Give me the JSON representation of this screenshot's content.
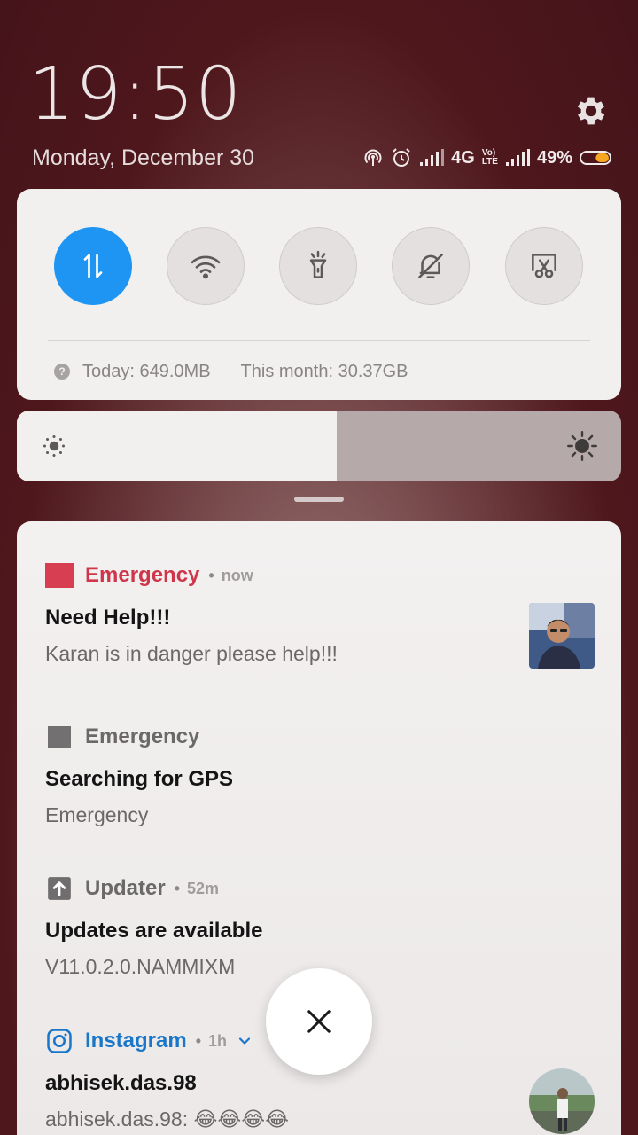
{
  "header": {
    "time": "19:50",
    "date": "Monday, December 30",
    "network_type": "4G",
    "volte_top": "Vo)",
    "volte_bottom": "LTE",
    "battery_percent": "49%",
    "battery_level": 0.49
  },
  "quick_settings": {
    "toggles": [
      {
        "name": "mobile-data",
        "icon": "data-arrows-icon",
        "active": true
      },
      {
        "name": "wifi",
        "icon": "wifi-icon",
        "active": false
      },
      {
        "name": "flashlight",
        "icon": "flashlight-icon",
        "active": false
      },
      {
        "name": "silent",
        "icon": "bell-off-icon",
        "active": false
      },
      {
        "name": "screenshot",
        "icon": "screenshot-icon",
        "active": false
      }
    ],
    "data_today": "Today: 649.0MB",
    "data_month": "This month: 30.37GB"
  },
  "brightness": {
    "level": 0.53
  },
  "notifications": [
    {
      "app": "Emergency",
      "app_color": "#d0364b",
      "time": "now",
      "title": "Need Help!!!",
      "text": "Karan is in danger please help!!!",
      "icon": "emergency-square-icon"
    },
    {
      "app": "Emergency",
      "app_color": "#6b6868",
      "title": "Searching for GPS",
      "text": "Emergency",
      "icon": "emergency-square-icon"
    },
    {
      "app": "Updater",
      "app_color": "#6b6868",
      "time": "52m",
      "title": "Updates are available",
      "text": "V11.0.2.0.NAMMIXM",
      "icon": "upload-arrow-icon"
    },
    {
      "app": "Instagram",
      "app_color": "#1a76c8",
      "time": "1h",
      "title": "abhisek.das.98",
      "text": "abhisek.das.98: 😂😂😂😂",
      "icon": "instagram-icon"
    }
  ],
  "colors": {
    "accent": "#1e95f3",
    "emergency": "#d0364b",
    "instagram": "#1a76c8"
  }
}
